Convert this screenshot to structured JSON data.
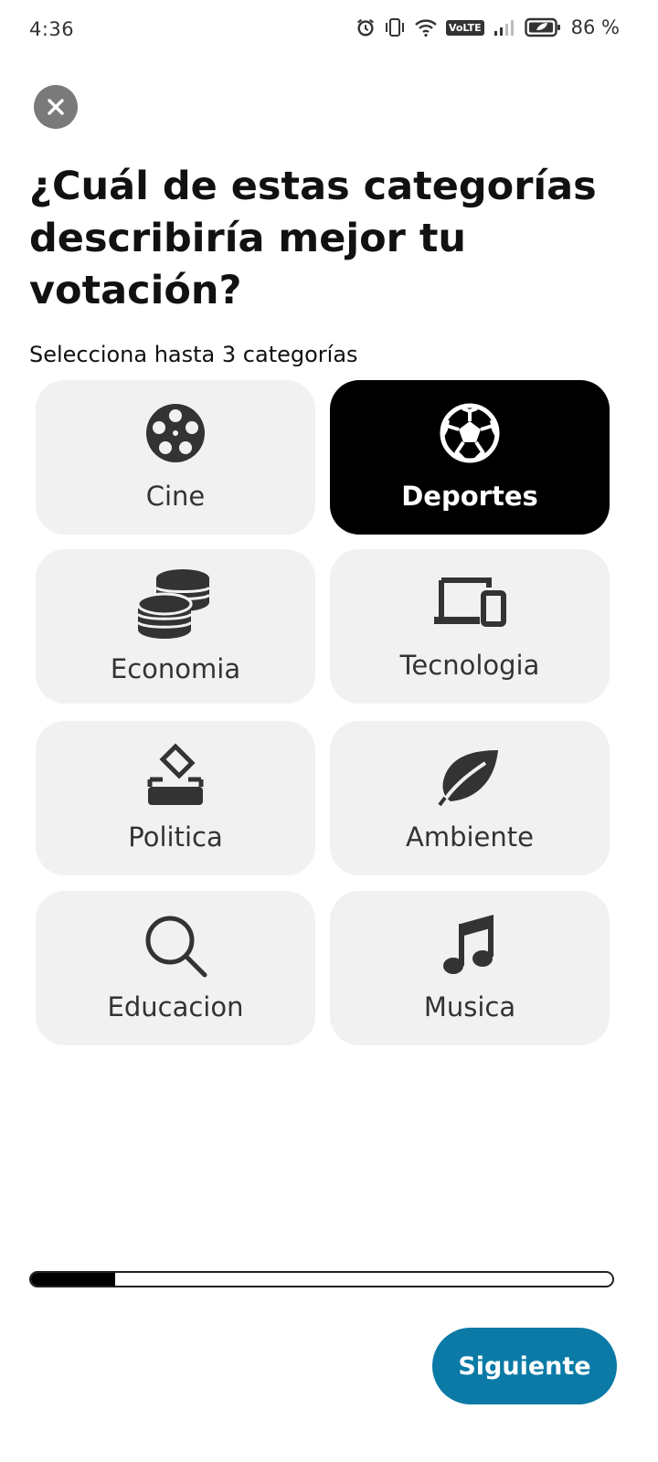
{
  "status_bar": {
    "time": "4:36",
    "network": "VoLTE",
    "battery": "86 %"
  },
  "close_button": {
    "icon": "close-icon"
  },
  "question": {
    "title": "¿Cuál de estas categorías describiría mejor tu votación?",
    "subtitle": "Selecciona hasta 3 categorías"
  },
  "categories": [
    {
      "label": "Cine",
      "icon": "film-reel-icon",
      "selected": false
    },
    {
      "label": "Deportes",
      "icon": "soccer-ball-icon",
      "selected": true
    },
    {
      "label": "Economia",
      "icon": "coins-icon",
      "selected": false
    },
    {
      "label": "Tecnologia",
      "icon": "devices-icon",
      "selected": false
    },
    {
      "label": "Politica",
      "icon": "ballot-box-icon",
      "selected": false
    },
    {
      "label": "Ambiente",
      "icon": "leaf-icon",
      "selected": false
    },
    {
      "label": "Educacion",
      "icon": "search-icon",
      "selected": false
    },
    {
      "label": "Musica",
      "icon": "music-note-icon",
      "selected": false
    }
  ],
  "progress": {
    "fraction": 0.145
  },
  "footer": {
    "next_label": "Siguiente"
  },
  "colors": {
    "accent": "#0b7aa6",
    "card_bg": "#f1f1f1",
    "selected_bg": "#000000"
  }
}
